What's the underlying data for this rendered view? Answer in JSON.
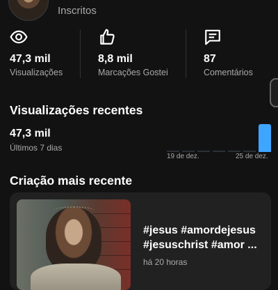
{
  "channel": {
    "subscribers_label": "Inscritos"
  },
  "stats": [
    {
      "value": "47,3 mil",
      "label": "Visualizações",
      "icon": "eye-icon"
    },
    {
      "value": "8,8 mil",
      "label": "Marcações Gostei",
      "icon": "thumbs-up-icon"
    },
    {
      "value": "87",
      "label": "Comentários",
      "icon": "comment-icon"
    }
  ],
  "recent_views": {
    "title": "Visualizações recentes",
    "value": "47,3 mil",
    "period": "Últimos 7 dias",
    "x_start": "19 de dez.",
    "x_end": "25 de dez.",
    "accent": "#3ea6ff",
    "bar_levels": [
      0,
      0,
      0,
      0,
      0,
      0,
      1
    ]
  },
  "latest": {
    "title": "Criação mais recente",
    "line1": "#jesus #amordejesus",
    "line2": "#jesuschrist #amor ...",
    "time": "há 20 horas"
  }
}
